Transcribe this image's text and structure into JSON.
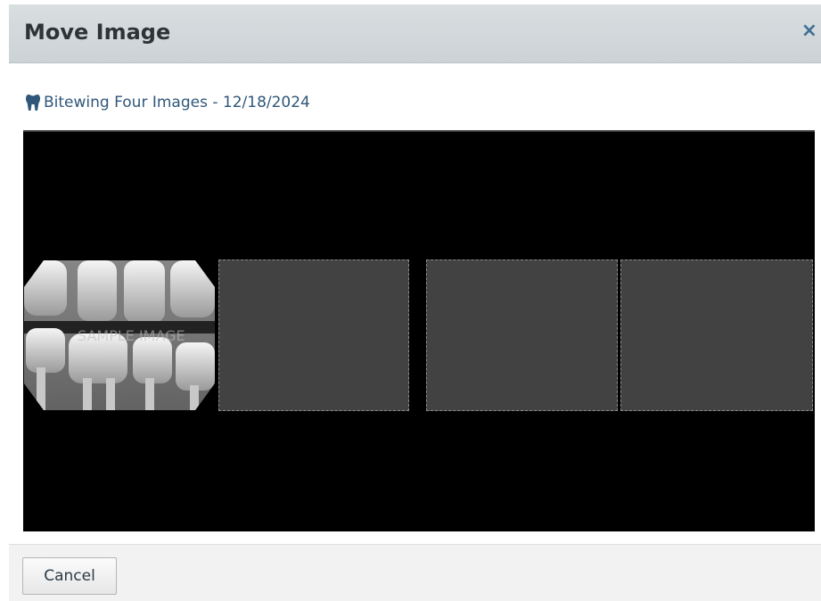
{
  "dialog": {
    "title": "Move Image",
    "close_glyph": "×"
  },
  "study": {
    "icon": "tooth-icon",
    "label": "Bitewing Four Images - 12/18/2024"
  },
  "image_slots": [
    {
      "type": "xray",
      "watermark": "SAMPLE IMAGE"
    },
    {
      "type": "empty"
    },
    {
      "type": "empty"
    },
    {
      "type": "empty"
    }
  ],
  "footer": {
    "cancel_label": "Cancel"
  },
  "colors": {
    "header_bg": "#d3d9dc",
    "title_link": "#30577a",
    "close": "#3f6e95",
    "empty_slot": "#424242",
    "viewer_bg": "#000000"
  }
}
